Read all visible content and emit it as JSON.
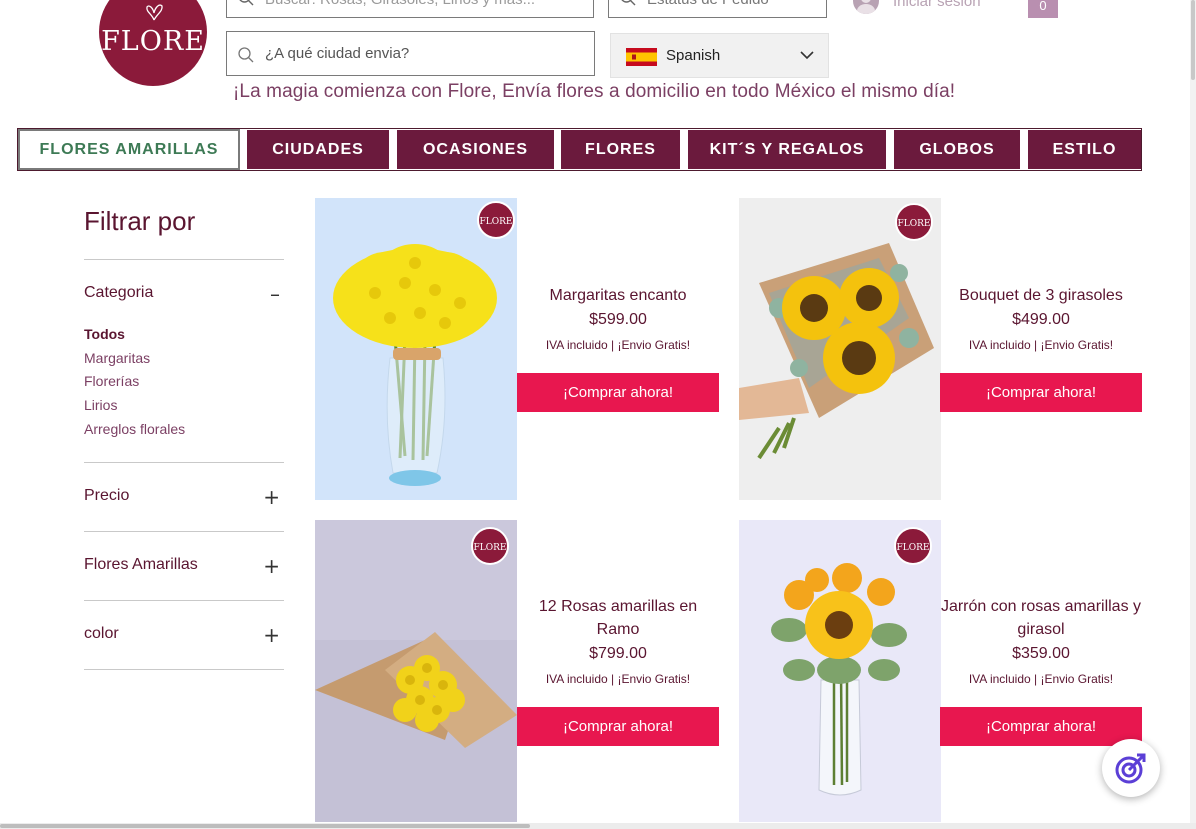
{
  "brand": {
    "logo_text": "FLORE",
    "badge_text": "FLORE",
    "accent": "#8b1a3a",
    "nav_color": "#6b1a3d",
    "buy_color": "#e8174f"
  },
  "header": {
    "top_search_placeholder": "Buscar: Rosas, Girasoles, Lirios y más...",
    "order_status_placeholder": "Estatus de Pedido",
    "login_label": "Iniciar sesión",
    "cart_count": "0",
    "city_search_placeholder": "¿A qué ciudad envia?",
    "language": "Spanish",
    "tagline": "¡La magia comienza con Flore, Envía flores a domicilio en todo México el mismo día!"
  },
  "nav": {
    "items": [
      {
        "label": "FLORES AMARILLAS"
      },
      {
        "label": "CIUDADES"
      },
      {
        "label": "OCASIONES"
      },
      {
        "label": "FLORES"
      },
      {
        "label": "KIT´S Y REGALOS"
      },
      {
        "label": "GLOBOS"
      },
      {
        "label": "ESTILO"
      }
    ]
  },
  "sidebar": {
    "title": "Filtrar por",
    "category": {
      "label": "Categoria",
      "toggle": "–",
      "items": [
        "Todos",
        "Margaritas",
        "Florerías",
        "Lirios",
        "Arreglos florales"
      ]
    },
    "sections": [
      {
        "label": "Precio",
        "toggle": "+"
      },
      {
        "label": "Flores Amarillas",
        "toggle": "+"
      },
      {
        "label": "color",
        "toggle": "+"
      }
    ]
  },
  "products": [
    {
      "name": "Margaritas encanto",
      "price": "$599.00",
      "note": "IVA incluido | ¡Envio Gratis!",
      "cta": "¡Comprar ahora!"
    },
    {
      "name": "Bouquet de 3 girasoles",
      "price": "$499.00",
      "note": "IVA incluido | ¡Envio Gratis!",
      "cta": "¡Comprar ahora!"
    },
    {
      "name": "12 Rosas amarillas en Ramo",
      "price": "$799.00",
      "note": "IVA incluido | ¡Envio Gratis!",
      "cta": "¡Comprar ahora!"
    },
    {
      "name": "Jarrón con rosas amarillas y girasol",
      "price": "$359.00",
      "note": "IVA incluido | ¡Envio Gratis!",
      "cta": "¡Comprar ahora!"
    }
  ]
}
